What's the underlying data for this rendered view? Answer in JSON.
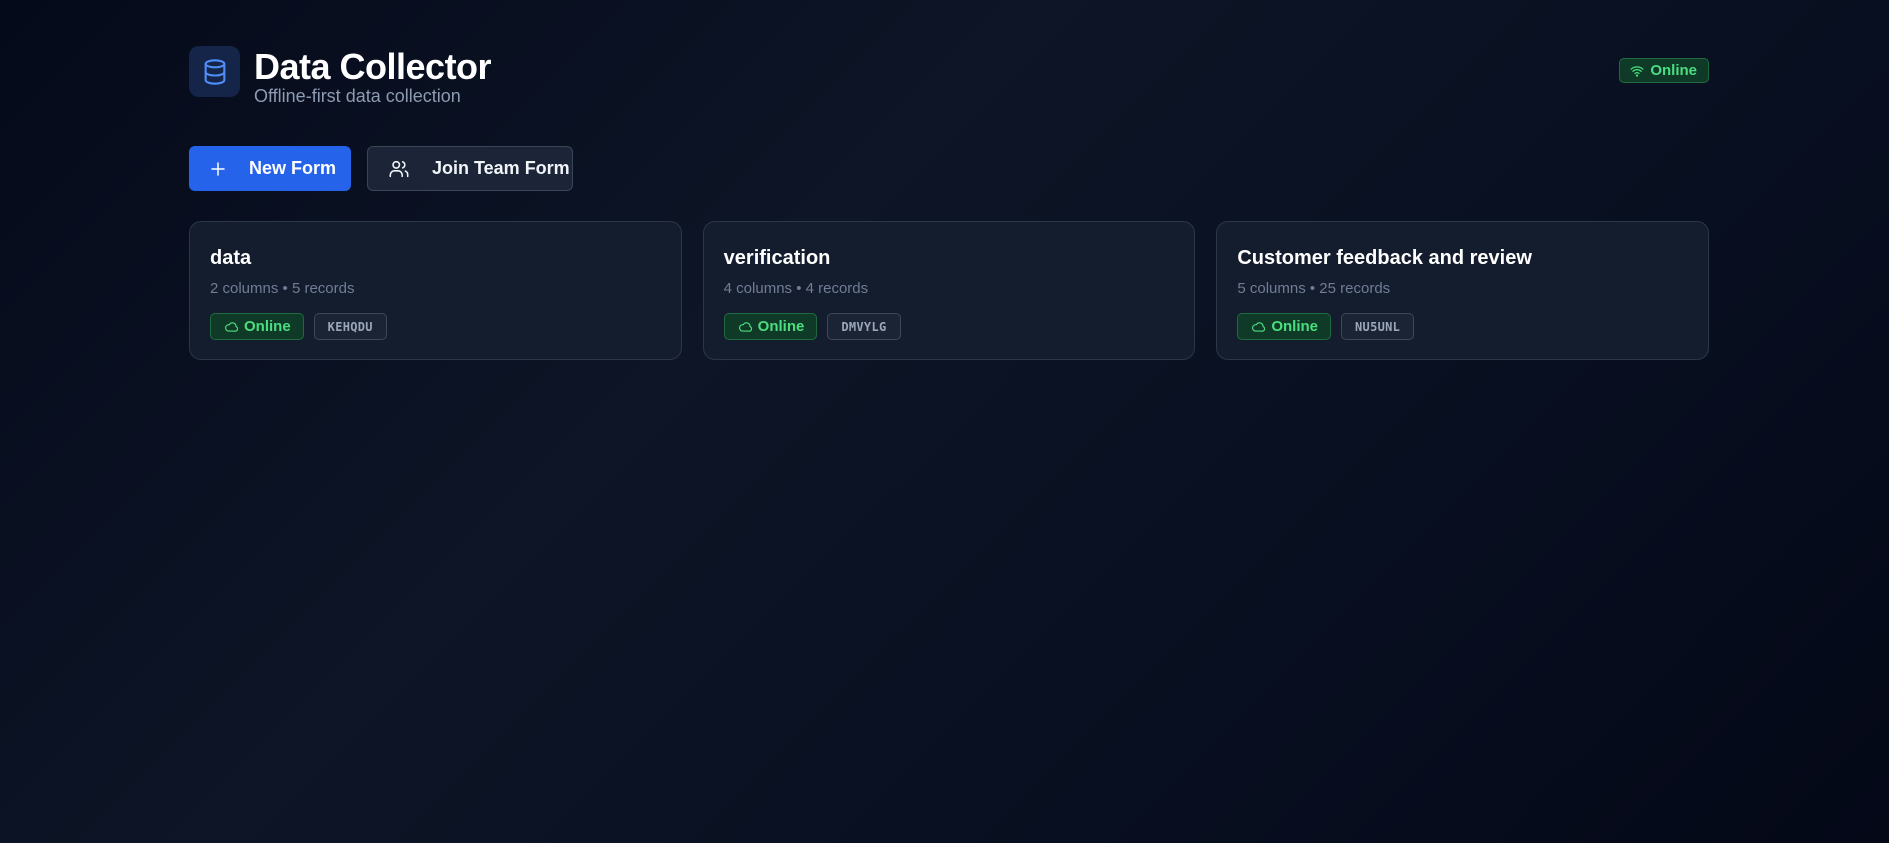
{
  "header": {
    "title": "Data Collector",
    "subtitle": "Offline-first data collection",
    "logo_icon": "database-icon",
    "status": {
      "label": "Online",
      "icon": "wifi-icon",
      "color": "#4ade80"
    }
  },
  "actions": {
    "new_form_label": "New Form",
    "new_form_icon": "plus-icon",
    "join_team_label": "Join Team Form",
    "join_team_icon": "users-icon"
  },
  "colors": {
    "accent": "#2563eb",
    "online": "#4ade80",
    "background": "#0a1122",
    "card": "#141d2e"
  },
  "forms": [
    {
      "title": "data",
      "meta": "2 columns • 5 records",
      "status": "Online",
      "status_icon": "cloud-icon",
      "code": "KEHQDU"
    },
    {
      "title": "verification",
      "meta": "4 columns • 4 records",
      "status": "Online",
      "status_icon": "cloud-icon",
      "code": "DMVYLG"
    },
    {
      "title": "Customer feedback and review",
      "meta": "5 columns • 25 records",
      "status": "Online",
      "status_icon": "cloud-icon",
      "code": "NU5UNL"
    }
  ]
}
